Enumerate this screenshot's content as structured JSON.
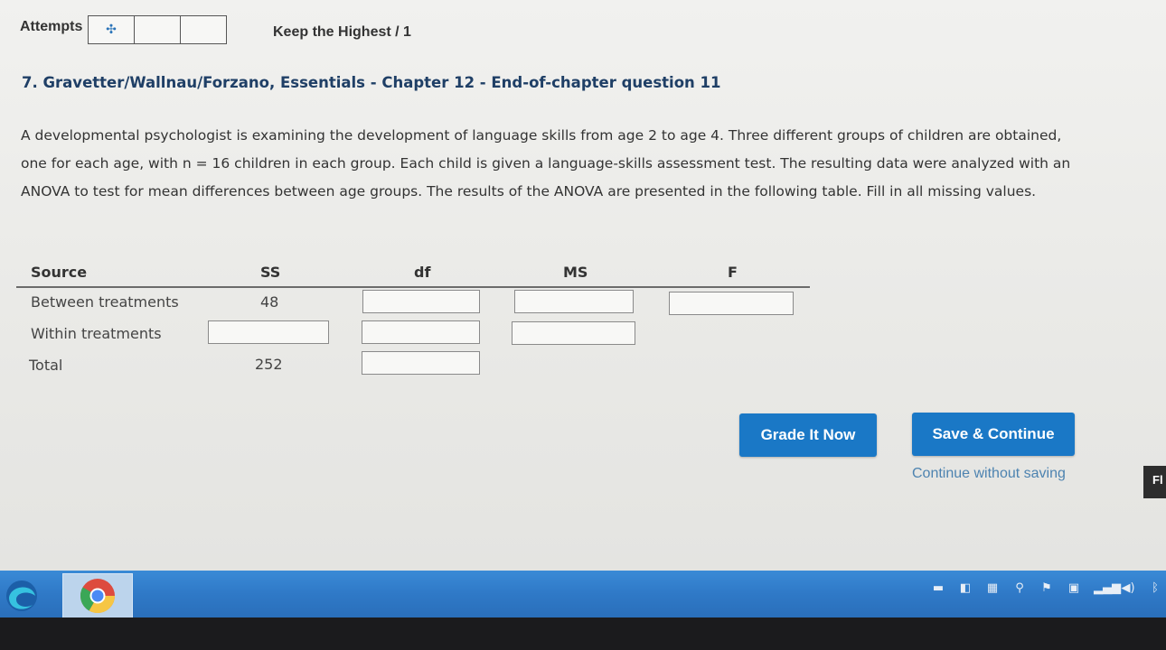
{
  "attempts": {
    "label": "Attempts",
    "keep_label": "Keep the Highest / 1"
  },
  "question": {
    "title": "7. Gravetter/Wallnau/Forzano, Essentials - Chapter 12 - End-of-chapter question 11",
    "line1": "A developmental psychologist is examining the development of language skills from age 2 to age 4. Three different groups of children are obtained,",
    "line2": "one for each age, with n = 16 children in each group. Each child is given a language-skills assessment test. The resulting data were analyzed with an",
    "line3": "ANOVA to test for mean differences between age groups. The results of the ANOVA are presented in the following table. Fill in all missing values."
  },
  "table": {
    "headers": {
      "source": "Source",
      "ss": "SS",
      "df": "df",
      "ms": "MS",
      "f": "F"
    },
    "rows": [
      {
        "source": "Between treatments",
        "ss": "48"
      },
      {
        "source": "Within treatments",
        "ss": ""
      },
      {
        "source": "Total",
        "ss": "252"
      }
    ]
  },
  "actions": {
    "grade_label": "Grade It Now",
    "save_label": "Save & Continue",
    "continue_label": "Continue without saving",
    "edge_tab": "Fl"
  },
  "colors": {
    "primary_button": "#1a78c6",
    "title_text": "#1f3f66",
    "taskbar": "#2f79c7"
  },
  "taskbar": {
    "pinned": [
      "edge-icon",
      "chrome-icon"
    ],
    "tray": [
      "battery-icon",
      "network-icon",
      "flag-icon",
      "signal-icon",
      "volume-icon",
      "bluetooth-icon"
    ]
  }
}
